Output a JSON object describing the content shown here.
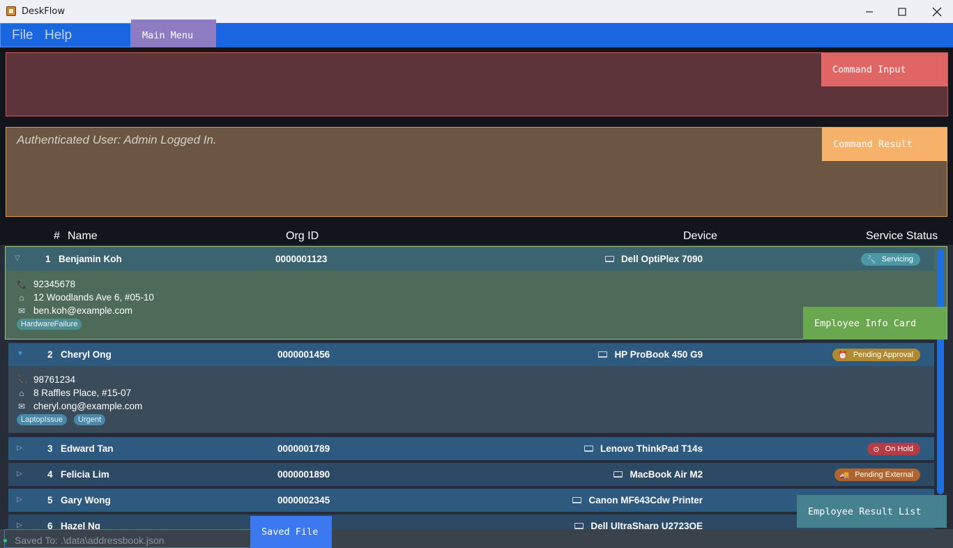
{
  "window": {
    "title": "DeskFlow"
  },
  "menu": {
    "file": "File",
    "help": "Help"
  },
  "overlays": {
    "main_menu": "Main Menu",
    "command_input": "Command Input",
    "command_result": "Command Result",
    "employee_info_card": "Employee Info Card",
    "employee_result_list": "Employee Result List",
    "saved_file": "Saved File"
  },
  "command_result": {
    "text": "Authenticated User: Admin Logged In."
  },
  "list_header": {
    "index": "#",
    "name": "Name",
    "org_id": "Org ID",
    "device": "Device",
    "service_status": "Service Status"
  },
  "employees": [
    {
      "index": "1",
      "name": "Benjamin Koh",
      "org_id": "0000001123",
      "device": "Dell OptiPlex 7090",
      "status": "Servicing",
      "status_icon": "wrench-icon",
      "status_color": "#4a98a6",
      "phone": "92345678",
      "address": "12 Woodlands Ave 6, #05-10",
      "email": "ben.koh@example.com",
      "tags": [
        "HardwareFailure"
      ]
    },
    {
      "index": "2",
      "name": "Cheryl Ong",
      "org_id": "0000001456",
      "device": "HP ProBook 450 G9",
      "status": "Pending Approval",
      "status_icon": "clock-icon",
      "status_color": "#b08a2e",
      "phone": "98761234",
      "address": "8 Raffles Place, #15-07",
      "email": "cheryl.ong@example.com",
      "tags": [
        "LaptopIssue",
        "Urgent"
      ]
    },
    {
      "index": "3",
      "name": "Edward Tan",
      "org_id": "0000001789",
      "device": "Lenovo ThinkPad T14s",
      "status": "On Hold",
      "status_icon": "pause-icon",
      "status_color": "#b53c45"
    },
    {
      "index": "4",
      "name": "Felicia Lim",
      "org_id": "0000001890",
      "device": "MacBook Air M2",
      "status": "Pending External",
      "status_icon": "truck-icon",
      "status_color": "#b0652e"
    },
    {
      "index": "5",
      "name": "Gary Wong",
      "org_id": "0000002345",
      "device": "Canon MF643Cdw Printer"
    },
    {
      "index": "6",
      "name": "Hazel Ng",
      "device": "Dell UltraSharp U2723QE"
    }
  ],
  "footer": {
    "saved_to": "Saved To:  .\\data\\addressbook.json"
  }
}
